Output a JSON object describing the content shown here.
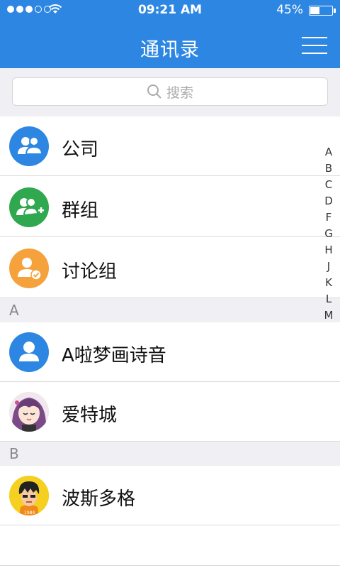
{
  "status": {
    "time": "09:21 AM",
    "battery": "45%"
  },
  "header": {
    "title": "通讯录"
  },
  "search": {
    "placeholder": "搜索"
  },
  "entries": [
    {
      "label": "公司",
      "color": "#2d87e2",
      "icon": "company-icon"
    },
    {
      "label": "群组",
      "color": "#2fa84f",
      "icon": "group-add-icon"
    },
    {
      "label": "讨论组",
      "color": "#f6a23c",
      "icon": "discussion-icon"
    }
  ],
  "sections": [
    {
      "letter": "A",
      "contacts": [
        {
          "name": "A啦梦画诗音",
          "avatar": "default-person-avatar",
          "color": "#2d87e2"
        },
        {
          "name": "爱特城",
          "avatar": "anime-girl-avatar"
        }
      ]
    },
    {
      "letter": "B",
      "contacts": [
        {
          "name": "波斯多格",
          "avatar": "cartoon-boy-avatar"
        }
      ]
    }
  ],
  "index_letters": [
    "A",
    "B",
    "C",
    "D",
    "F",
    "G",
    "H",
    "J",
    "K",
    "L",
    "M"
  ]
}
